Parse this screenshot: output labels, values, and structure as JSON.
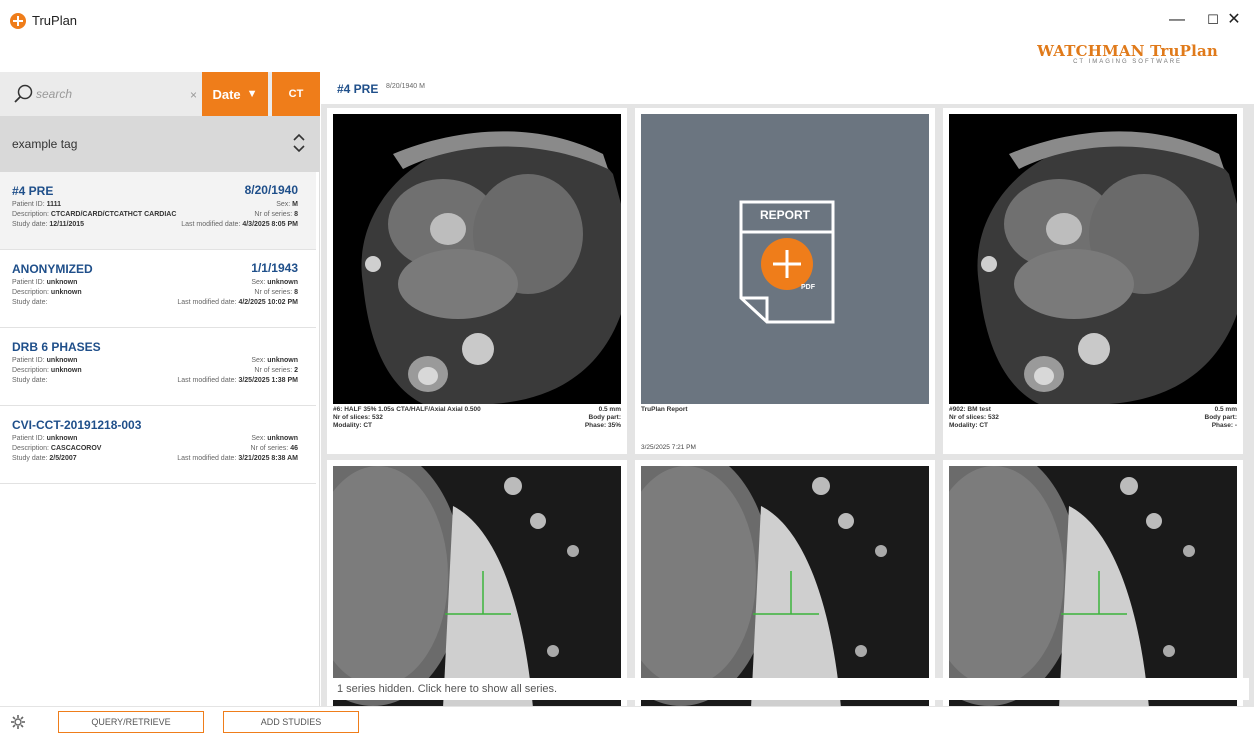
{
  "window": {
    "title": "TruPlan",
    "minimize_glyph": "—",
    "maximize_glyph": "☐",
    "close_glyph": "✕",
    "brand_name": "WATCHMAN TruPlan",
    "brand_sub": "CT IMAGING SOFTWARE",
    "accent_color": "#ef7d1a"
  },
  "left": {
    "search_placeholder": "search",
    "clear_glyph": "×",
    "date_label": "Date",
    "date_arrow": "▼",
    "ct_label": "CT",
    "tag_label": "example tag",
    "studies": [
      {
        "name": "#4 PRE",
        "date": "8/20/1940",
        "patient_id_label": "Patient ID:",
        "patient_id": "1111",
        "sex_label": "Sex:",
        "sex": "M",
        "desc_label": "Description:",
        "desc": "CTCARD/CARD/CTCATHCT CARDIAC",
        "series_label": "Nr of series:",
        "series": "8",
        "study_date_label": "Study date:",
        "study_date": "12/11/2015",
        "modified_label": "Last modified date:",
        "modified": "4/3/2025 8:05 PM"
      },
      {
        "name": "ANONYMIZED",
        "date": "1/1/1943",
        "patient_id_label": "Patient ID:",
        "patient_id": "unknown",
        "sex_label": "Sex:",
        "sex": "unknown",
        "desc_label": "Description:",
        "desc": "unknown",
        "series_label": "Nr of series:",
        "series": "8",
        "study_date_label": "Study date:",
        "study_date": "",
        "modified_label": "Last modified date:",
        "modified": "4/2/2025 10:02 PM"
      },
      {
        "name": "DRB 6 PHASES",
        "date": "",
        "patient_id_label": "Patient ID:",
        "patient_id": "unknown",
        "sex_label": "Sex:",
        "sex": "unknown",
        "desc_label": "Description:",
        "desc": "unknown",
        "series_label": "Nr of series:",
        "series": "2",
        "study_date_label": "Study date:",
        "study_date": "",
        "modified_label": "Last modified date:",
        "modified": "3/25/2025 1:38 PM"
      },
      {
        "name": "CVI-CCT-20191218-003",
        "date": "",
        "patient_id_label": "Patient ID:",
        "patient_id": "unknown",
        "sex_label": "Sex:",
        "sex": "unknown",
        "desc_label": "Description:",
        "desc": "CASCACOROV",
        "series_label": "Nr of series:",
        "series": "46",
        "study_date_label": "Study date:",
        "study_date": "2/5/2007",
        "modified_label": "Last modified date:",
        "modified": "3/21/2025 8:38 AM"
      }
    ]
  },
  "main": {
    "title": "#4 PRE",
    "subtitle": "8/20/1940 M",
    "tiles": {
      "t1": {
        "series": "#6: HALF 35% 1.05s CTA/HALF/Axial Axial 0.500",
        "thickness": "0.5 mm",
        "slices_label": "Nr of slices:",
        "slices": "532",
        "body_part_label": "Body part:",
        "modality_label": "Modality:",
        "modality": "CT",
        "phase_label": "Phase:",
        "phase": "35%"
      },
      "t2": {
        "report_word": "REPORT",
        "pdf_word": "PDF",
        "name": "TruPlan Report",
        "date": "3/25/2025 7:21 PM"
      },
      "t3": {
        "series": "#902: BM test",
        "thickness": "0.5 mm",
        "slices_label": "Nr of slices:",
        "slices": "532",
        "body_part_label": "Body part:",
        "modality_label": "Modality:",
        "modality": "CT",
        "phase_label": "Phase:",
        "phase": "-"
      }
    },
    "hidden_notice": "1 series hidden. Click here to show all series."
  },
  "bottom": {
    "query_label": "QUERY/RETRIEVE",
    "add_label": "ADD STUDIES"
  }
}
